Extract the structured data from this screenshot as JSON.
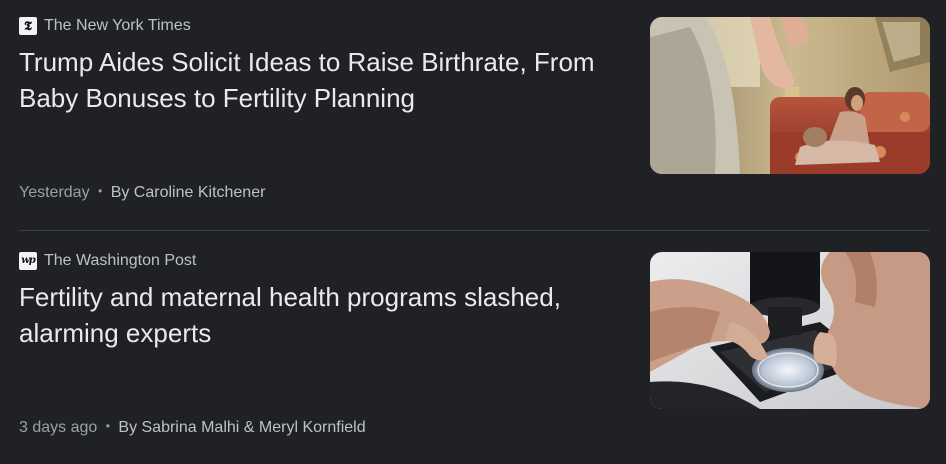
{
  "articles": [
    {
      "source": {
        "name": "The New York Times",
        "logo_glyph": "𝕿",
        "logo_icon": "nyt-logo-icon"
      },
      "headline": "Trump Aides Solicit Ideas to Raise Birthrate, From Baby Bonuses to Fertility Planning",
      "time": "Yesterday",
      "separator": "•",
      "byline": "By Caroline Kitchener",
      "thumbnail": {
        "icon": "family-photo-thumbnail"
      }
    },
    {
      "source": {
        "name": "The Washington Post",
        "logo_glyph": "wp",
        "logo_icon": "washington-post-logo-icon"
      },
      "headline": "Fertility and maternal health programs slashed, alarming experts",
      "time": "3 days ago",
      "separator": "•",
      "byline": "By Sabrina Malhi & Meryl Kornfield",
      "thumbnail": {
        "icon": "lab-microscope-photo-thumbnail"
      }
    }
  ],
  "colors": {
    "background": "#202124",
    "headline": "#e8eaed",
    "source": "#bdc1c6",
    "meta": "#9aa0a6",
    "divider": "#3c4043"
  }
}
